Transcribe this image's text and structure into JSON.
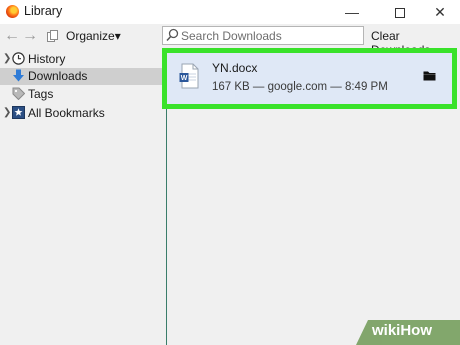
{
  "window": {
    "title": "Library"
  },
  "toolbar": {
    "organize_label": "Organize",
    "search_placeholder": "Search Downloads",
    "clear_label": "Clear Downloads"
  },
  "sidebar": {
    "items": [
      {
        "label": "History",
        "icon": "clock-icon",
        "expandable": true,
        "selected": false
      },
      {
        "label": "Downloads",
        "icon": "download-arrow-icon",
        "expandable": false,
        "selected": true
      },
      {
        "label": "Tags",
        "icon": "tag-icon",
        "expandable": false,
        "selected": false
      },
      {
        "label": "All Bookmarks",
        "icon": "bookmarks-star-icon",
        "expandable": true,
        "selected": false
      }
    ]
  },
  "downloads": [
    {
      "name": "YN.docx",
      "meta": "167 KB — google.com — 8:49 PM",
      "icon": "word-document-icon"
    }
  ],
  "watermark": {
    "text": "wikiHow"
  },
  "colors": {
    "highlight_border": "#39e22a",
    "selection_bg": "#dfe8f6",
    "sidebar_selected": "#cfcfcf"
  }
}
